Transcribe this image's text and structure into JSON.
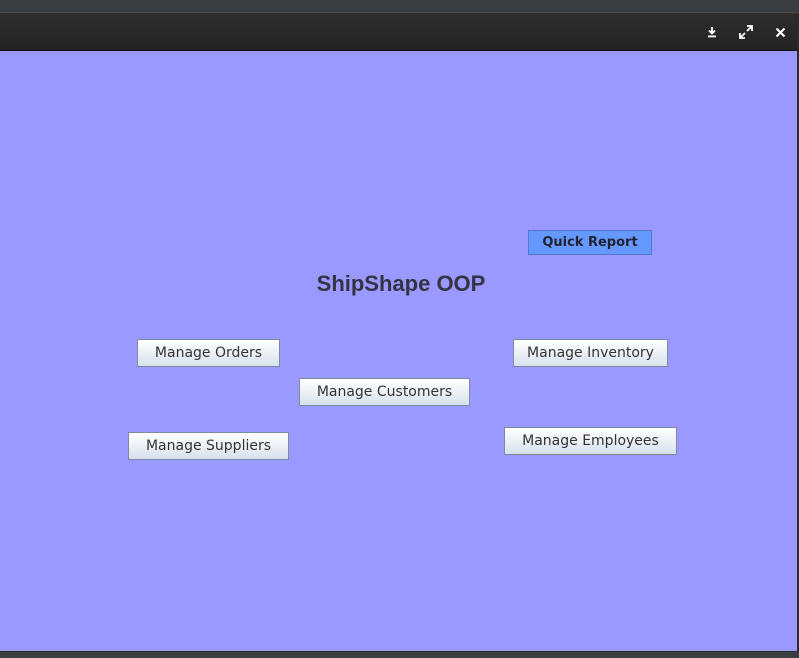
{
  "window": {
    "controls": {
      "minimize_icon": "download-icon",
      "maximize_icon": "expand-icon",
      "close_icon": "close-icon"
    }
  },
  "app": {
    "title": "ShipShape OOP",
    "background_color": "#9999ff",
    "buttons": {
      "quick_report": "Quick Report",
      "manage_orders": "Manage Orders",
      "manage_inventory": "Manage Inventory",
      "manage_customers": "Manage Customers",
      "manage_suppliers": "Manage Suppliers",
      "manage_employees": "Manage Employees"
    },
    "accent_color": "#6699ff"
  }
}
